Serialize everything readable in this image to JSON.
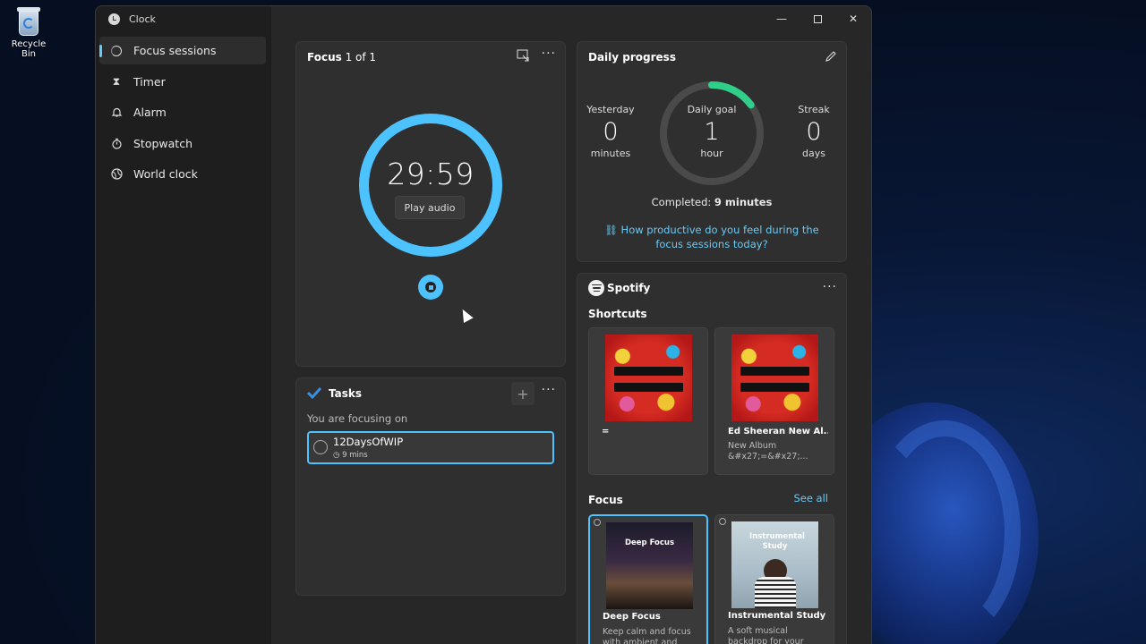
{
  "desktop": {
    "recycle_bin_label": "Recycle Bin"
  },
  "window": {
    "title": "Clock"
  },
  "nav": [
    {
      "label": "Focus sessions",
      "icon": "focus-icon",
      "active": true
    },
    {
      "label": "Timer",
      "icon": "hourglass-icon"
    },
    {
      "label": "Alarm",
      "icon": "bell-icon"
    },
    {
      "label": "Stopwatch",
      "icon": "stopwatch-icon"
    },
    {
      "label": "World clock",
      "icon": "globe-icon"
    }
  ],
  "focus": {
    "title_prefix": "Focus",
    "title_count": "1 of 1",
    "timer": "29:59",
    "play_audio": "Play audio"
  },
  "daily_progress": {
    "title": "Daily progress",
    "yesterday_label": "Yesterday",
    "yesterday_value": "0",
    "yesterday_unit": "minutes",
    "goal_label": "Daily goal",
    "goal_value": "1",
    "goal_unit": "hour",
    "goal_progress": 0.15,
    "streak_label": "Streak",
    "streak_value": "0",
    "streak_unit": "days",
    "completed_label": "Completed:",
    "completed_value": "9 minutes",
    "feedback_link": "How productive do you feel during the focus sessions today?"
  },
  "tasks": {
    "title": "Tasks",
    "focusing_on": "You are focusing on",
    "task_name": "12DaysOfWIP",
    "task_time": "9 mins"
  },
  "spotify": {
    "brand": "Spotify",
    "shortcuts_label": "Shortcuts",
    "shortcuts": [
      {
        "title": "=",
        "subtitle": ""
      },
      {
        "title": "Ed Sheeran New Al...",
        "subtitle": "New Album &#x27;=&#x27;..."
      }
    ],
    "focus_label": "Focus",
    "see_all": "See all",
    "focus_playlists": [
      {
        "title": "Deep Focus",
        "art_text": "Deep Focus",
        "subtitle": "Keep calm and focus with ambient and"
      },
      {
        "title": "Instrumental Study",
        "art_text": "Instrumental Study",
        "subtitle": "A soft musical backdrop for your"
      }
    ]
  },
  "colors": {
    "accent": "#4cc2ff",
    "progress": "#2fcf8a",
    "link": "#69c9f5"
  }
}
